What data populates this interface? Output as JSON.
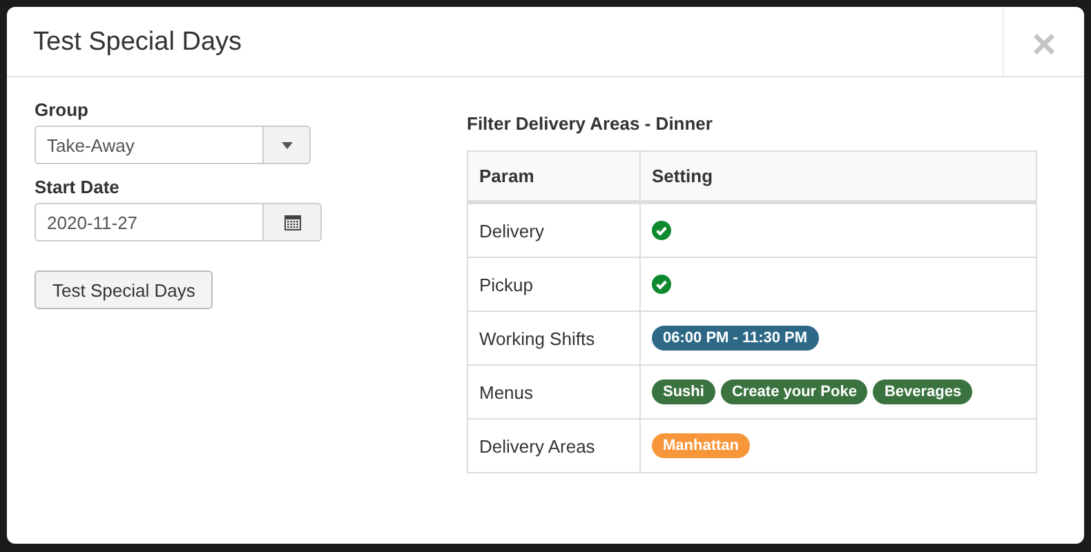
{
  "modal": {
    "title": "Test Special Days",
    "close": "×"
  },
  "form": {
    "group": {
      "label": "Group",
      "value": "Take-Away"
    },
    "start_date": {
      "label": "Start Date",
      "value": "2020-11-27"
    },
    "button": "Test Special Days"
  },
  "result": {
    "title": "Filter Delivery Areas - Dinner",
    "table": {
      "columns": [
        "Param",
        "Setting"
      ],
      "rows": [
        {
          "param": "Delivery",
          "kind": "check",
          "checked": true
        },
        {
          "param": "Pickup",
          "kind": "check",
          "checked": true
        },
        {
          "param": "Working Shifts",
          "kind": "tags",
          "tags": [
            {
              "text": "06:00 PM - 11:30 PM",
              "color": "#2d6987"
            }
          ]
        },
        {
          "param": "Menus",
          "kind": "tags",
          "tags": [
            {
              "text": "Sushi",
              "color": "#3a7340"
            },
            {
              "text": "Create your Poke",
              "color": "#3a7340"
            },
            {
              "text": "Beverages",
              "color": "#3a7340"
            }
          ]
        },
        {
          "param": "Delivery Areas",
          "kind": "tags",
          "tags": [
            {
              "text": "Manhattan",
              "color": "#f7963a"
            }
          ]
        }
      ]
    }
  }
}
